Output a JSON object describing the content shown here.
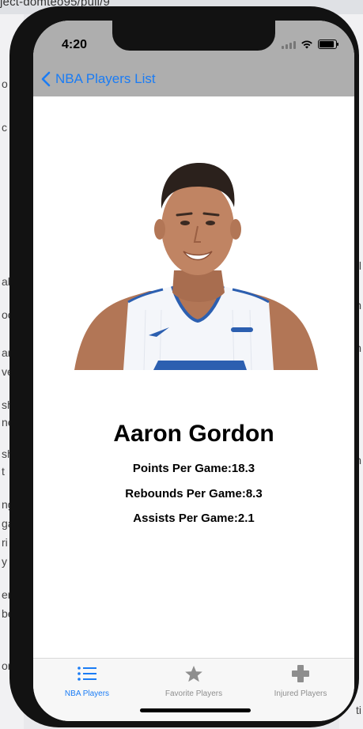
{
  "background": {
    "url_fragment": "ject-domteo95/pull/9",
    "left_fragments": [
      "o",
      "c",
      "ab",
      "oo",
      "am",
      "ve",
      "sh",
      "ne",
      "sh",
      "t",
      "ng",
      "ga",
      "ri",
      "y",
      "ers",
      "be",
      "or"
    ],
    "right_fragments": [
      "fl",
      "h",
      "ch",
      "ch",
      "ti"
    ]
  },
  "status_bar": {
    "time": "4:20"
  },
  "nav": {
    "back_label": "NBA Players List"
  },
  "player": {
    "name": "Aaron Gordon",
    "points": "Points Per Game:18.3",
    "rebounds": "Rebounds Per Game:8.3",
    "assists": "Assists Per Game:2.1"
  },
  "tabs": [
    {
      "label": "NBA Players",
      "icon": "list-icon",
      "active": true
    },
    {
      "label": "Favorite Players",
      "icon": "star-icon",
      "active": false
    },
    {
      "label": "Injured Players",
      "icon": "plus-icon",
      "active": false
    }
  ],
  "colors": {
    "accent": "#1a7cf5",
    "nav_background": "#aeaeae",
    "inactive_tab": "#8e8e8e"
  }
}
